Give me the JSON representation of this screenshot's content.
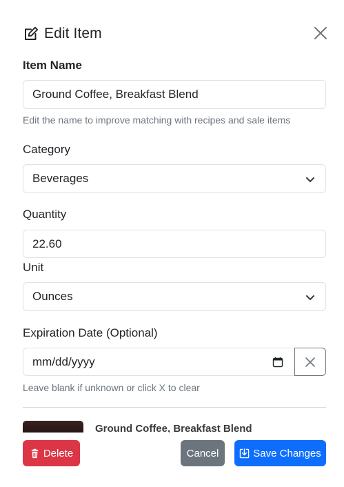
{
  "header": {
    "title": "Edit Item"
  },
  "item_name": {
    "label": "Item Name",
    "value": "Ground Coffee, Breakfast Blend",
    "help": "Edit the name to improve matching with recipes and sale items"
  },
  "category": {
    "label": "Category",
    "selected": "Beverages"
  },
  "quantity": {
    "label": "Quantity",
    "value": "22.60"
  },
  "unit": {
    "label": "Unit",
    "selected": "Ounces"
  },
  "expiration": {
    "label": "Expiration Date (Optional)",
    "placeholder": "mm/dd/yyyy",
    "help": "Leave blank if unknown or click X to clear"
  },
  "preview": {
    "name": "Ground Coffee, Breakfast Blend"
  },
  "footer": {
    "delete_label": "Delete",
    "cancel_label": "Cancel",
    "save_label": "Save Changes"
  },
  "colors": {
    "delete": "#dc3545",
    "cancel": "#6c757d",
    "save": "#0d6efd"
  },
  "icons": {
    "header": "pencil-square-icon",
    "close": "close-icon",
    "select": "chevron-down-icon",
    "calendar": "calendar-icon",
    "clear": "x-icon",
    "delete": "trash-icon",
    "save": "save-icon"
  }
}
